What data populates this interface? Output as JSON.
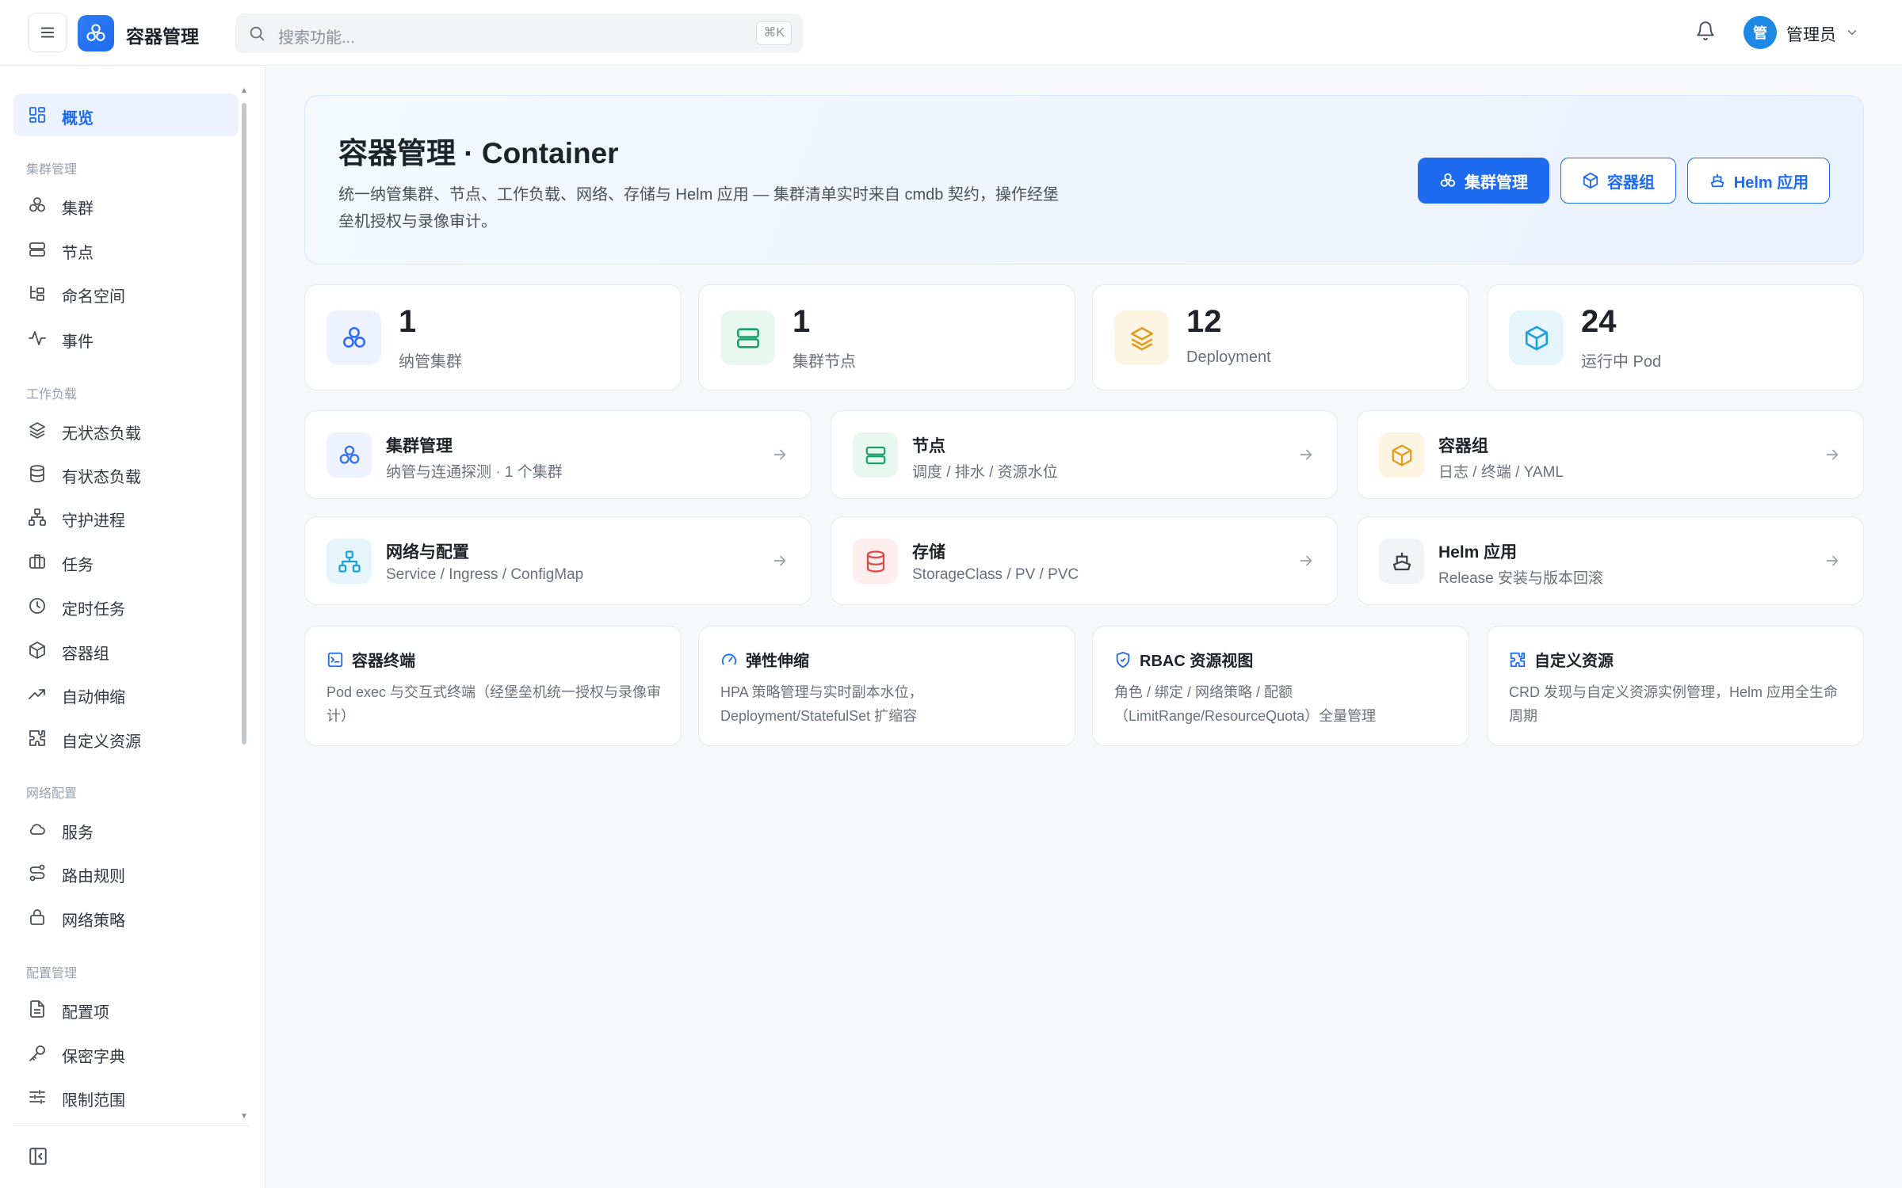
{
  "header": {
    "app_title": "容器管理",
    "search_placeholder": "搜索功能...",
    "search_shortcut": "⌘K",
    "user_avatar_text": "管",
    "user_name": "管理员"
  },
  "sidebar": {
    "overview": "概览",
    "groups": {
      "cluster": "集群管理",
      "workload": "工作负载",
      "network": "网络配置",
      "config": "配置管理"
    },
    "items": {
      "cluster": "集群",
      "node": "节点",
      "namespace": "命名空间",
      "event": "事件",
      "deployment": "无状态负载",
      "statefulset": "有状态负载",
      "daemonset": "守护进程",
      "job": "任务",
      "cronjob": "定时任务",
      "pod": "容器组",
      "hpa": "自动伸缩",
      "crd": "自定义资源",
      "service": "服务",
      "ingress": "路由规则",
      "netpolicy": "网络策略",
      "configmap": "配置项",
      "secret": "保密字典",
      "limitrange": "限制范围"
    }
  },
  "hero": {
    "title": "容器管理 · Container",
    "description": "统一纳管集群、节点、工作负载、网络、存储与 Helm 应用 — 集群清单实时来自 cmdb 契约，操作经堡垒机授权与录像审计。",
    "btn_cluster": "集群管理",
    "btn_pod": "容器组",
    "btn_helm": "Helm 应用"
  },
  "stats": [
    {
      "value": "1",
      "label": "纳管集群",
      "color": "#2f6ef3",
      "bg": "#edf2fe"
    },
    {
      "value": "1",
      "label": "集群节点",
      "color": "#16a36b",
      "bg": "#e8f7ef"
    },
    {
      "value": "12",
      "label": "Deployment",
      "color": "#e49b1a",
      "bg": "#fef4e4"
    },
    {
      "value": "24",
      "label": "运行中 Pod",
      "color": "#1aa0d8",
      "bg": "#e6f5fb"
    }
  ],
  "modules": [
    {
      "title": "集群管理",
      "sub": "纳管与连通探测 · 1 个集群",
      "color": "#2f6ef3",
      "bg": "#edf2fe"
    },
    {
      "title": "节点",
      "sub": "调度 / 排水 / 资源水位",
      "color": "#16a36b",
      "bg": "#e8f7ef"
    },
    {
      "title": "容器组",
      "sub": "日志 / 终端 / YAML",
      "color": "#e49b1a",
      "bg": "#fef4e4"
    },
    {
      "title": "网络与配置",
      "sub": "Service / Ingress / ConfigMap",
      "color": "#1aa0d8",
      "bg": "#e6f5fb"
    },
    {
      "title": "存储",
      "sub": "StorageClass / PV / PVC",
      "color": "#e04848",
      "bg": "#fdeded"
    },
    {
      "title": "Helm 应用",
      "sub": "Release 安装与版本回滚",
      "color": "#3c4048",
      "bg": "#f2f3f5"
    }
  ],
  "features": [
    {
      "title": "容器终端",
      "desc": "Pod exec 与交互式终端（经堡垒机统一授权与录像审计）"
    },
    {
      "title": "弹性伸缩",
      "desc": "HPA 策略管理与实时副本水位，Deployment/StatefulSet 扩缩容"
    },
    {
      "title": "RBAC 资源视图",
      "desc": "角色 / 绑定 / 网络策略 / 配额（LimitRange/ResourceQuota）全量管理"
    },
    {
      "title": "自定义资源",
      "desc": "CRD 发现与自定义资源实例管理，Helm 应用全生命周期"
    }
  ]
}
